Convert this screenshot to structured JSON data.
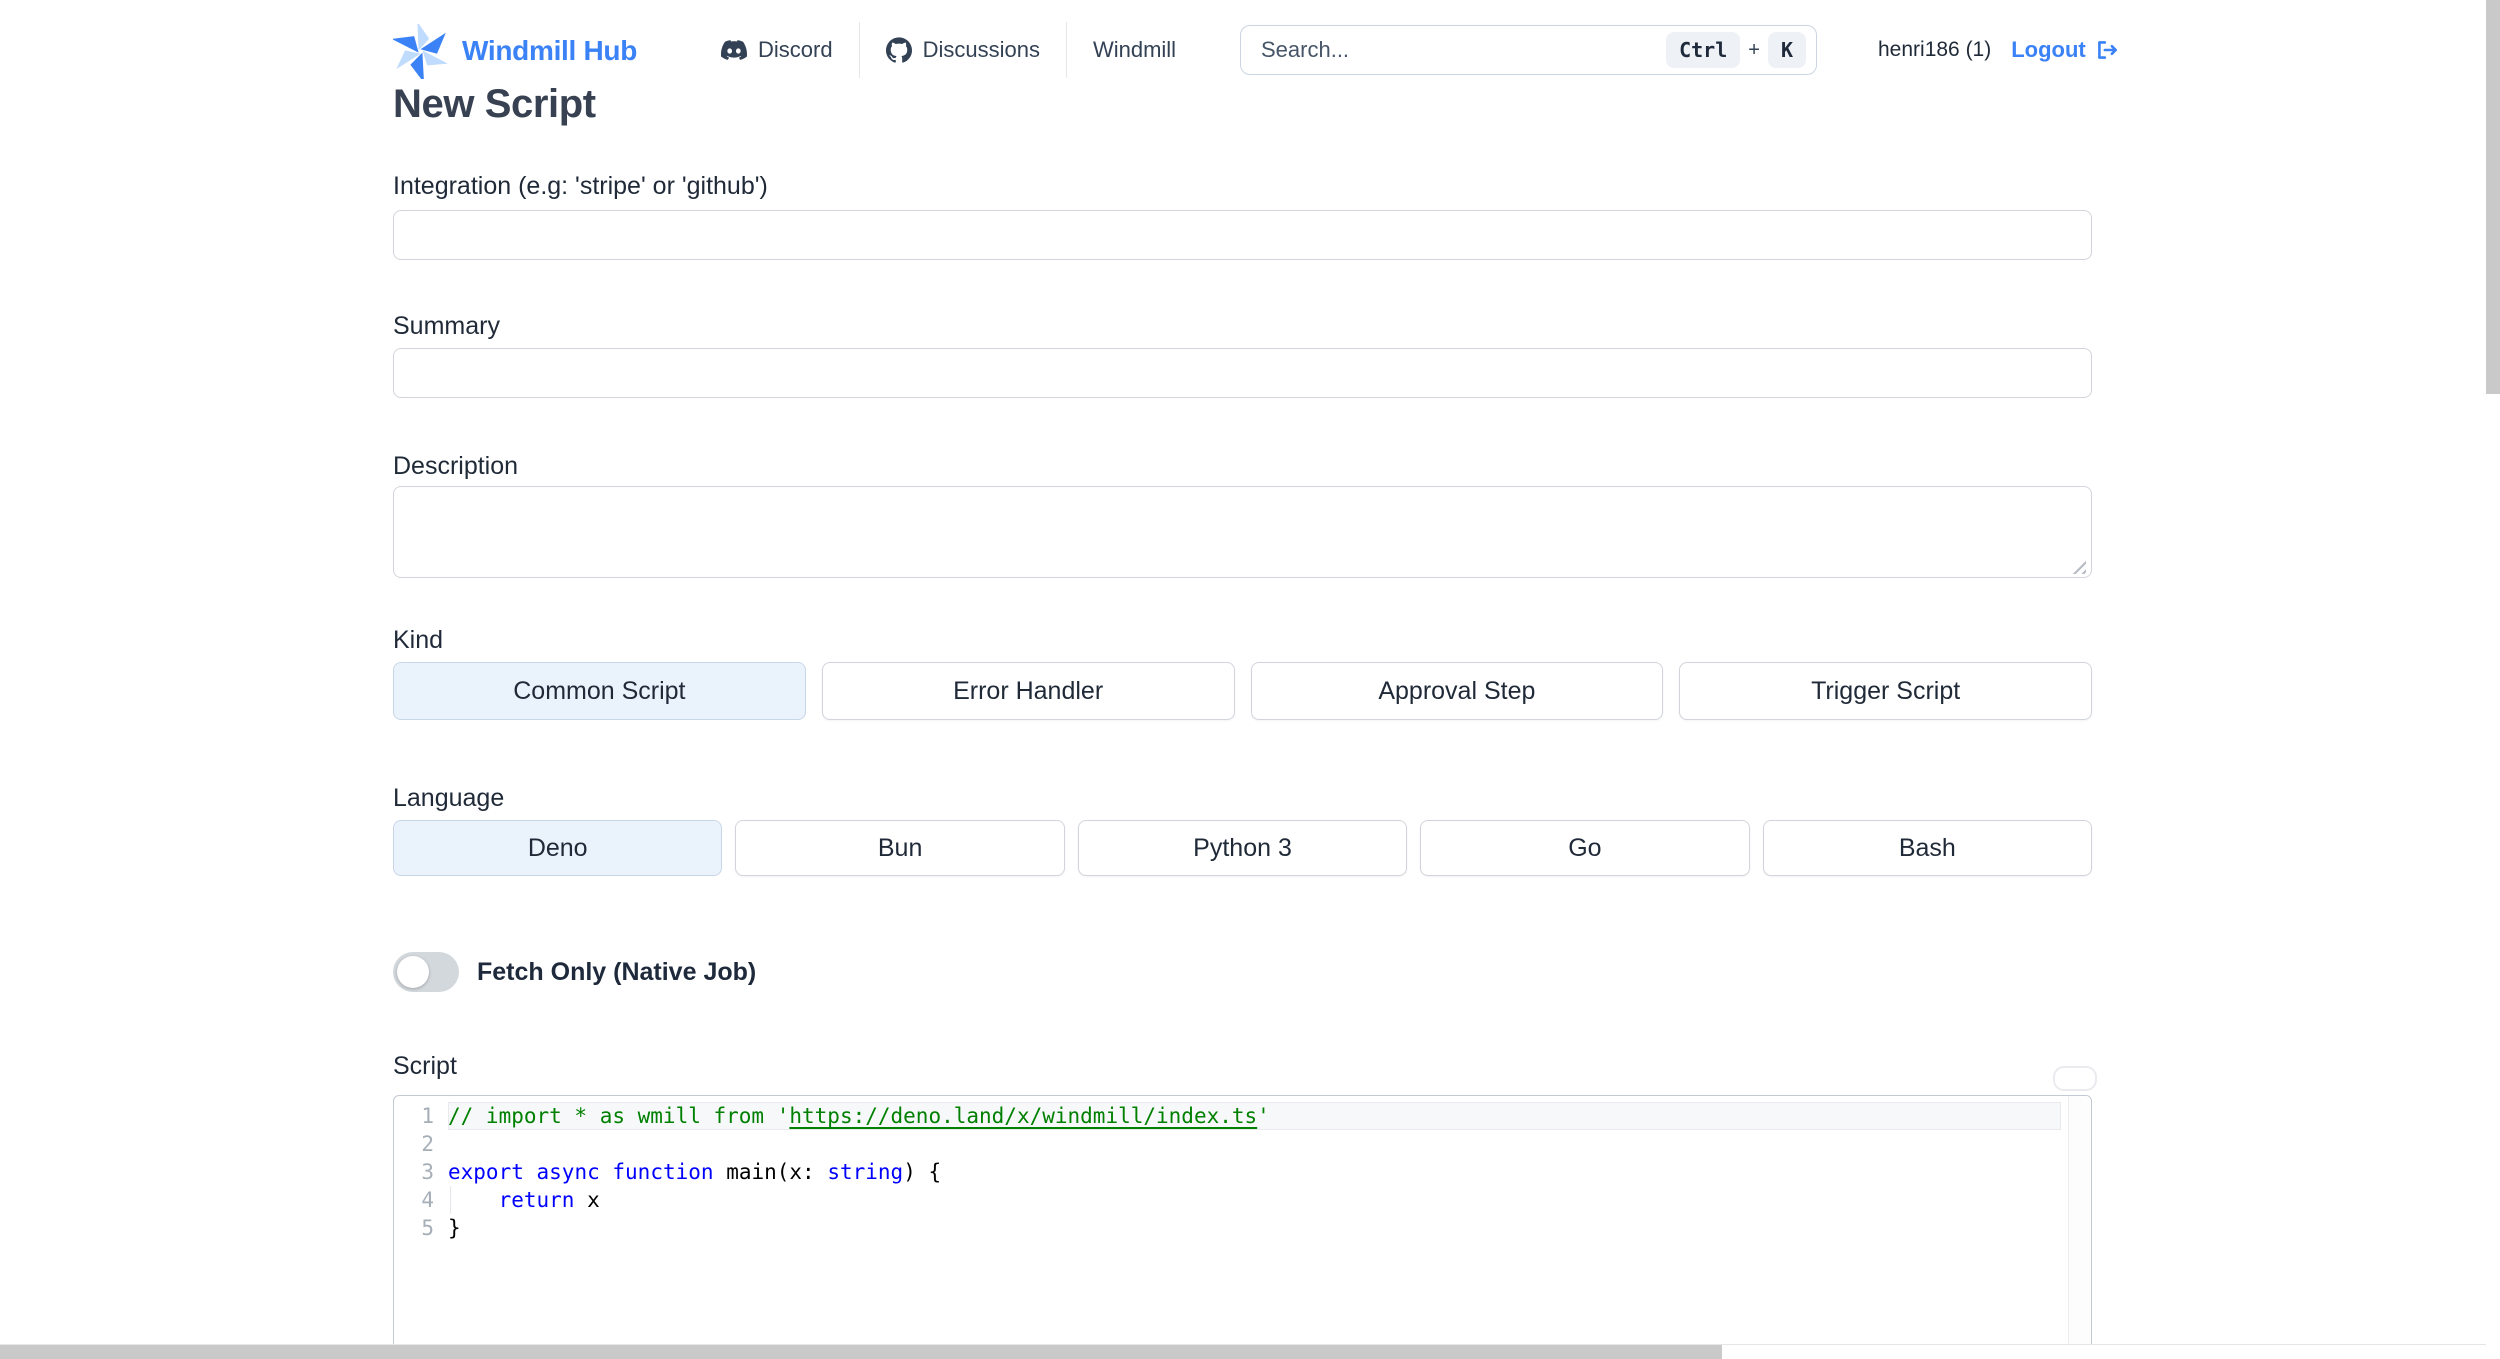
{
  "brand": {
    "name": "Windmill Hub"
  },
  "nav": {
    "items": [
      {
        "label": "Discord",
        "icon": "discord-icon"
      },
      {
        "label": "Discussions",
        "icon": "github-icon"
      },
      {
        "label": "Windmill",
        "icon": ""
      }
    ]
  },
  "search": {
    "placeholder": "Search...",
    "shortcut_keys": [
      "Ctrl",
      "K"
    ],
    "shortcut_separator": "+"
  },
  "user": {
    "name": "henri186 (1)",
    "logout_label": "Logout"
  },
  "page": {
    "title": "New Script"
  },
  "form": {
    "integration_label": "Integration (e.g: 'stripe' or 'github')",
    "integration_value": "",
    "summary_label": "Summary",
    "summary_value": "",
    "description_label": "Description",
    "description_value": "",
    "kind_label": "Kind",
    "kind_options": [
      "Common Script",
      "Error Handler",
      "Approval Step",
      "Trigger Script"
    ],
    "kind_selected": "Common Script",
    "language_label": "Language",
    "language_options": [
      "Deno",
      "Bun",
      "Python 3",
      "Go",
      "Bash"
    ],
    "language_selected": "Deno",
    "fetch_only_label": "Fetch Only (Native Job)",
    "fetch_only_on": false,
    "script_label": "Script"
  },
  "editor": {
    "lines": [
      {
        "num": "1",
        "current": true,
        "tokens": [
          [
            "comment",
            "// import * as wmill from '"
          ],
          [
            "comment-link",
            "https://deno.land/x/windmill/index.ts"
          ],
          [
            "comment",
            "'"
          ]
        ]
      },
      {
        "num": "2",
        "tokens": []
      },
      {
        "num": "3",
        "tokens": [
          [
            "kw",
            "export"
          ],
          [
            "plain",
            " "
          ],
          [
            "kw",
            "async"
          ],
          [
            "plain",
            " "
          ],
          [
            "kw",
            "function"
          ],
          [
            "plain",
            " main(x: "
          ],
          [
            "type",
            "string"
          ],
          [
            "plain",
            ") {"
          ]
        ]
      },
      {
        "num": "4",
        "indent_guide": true,
        "tokens": [
          [
            "plain",
            "    "
          ],
          [
            "kw",
            "return"
          ],
          [
            "plain",
            " x"
          ]
        ]
      },
      {
        "num": "5",
        "tokens": [
          [
            "plain",
            "}"
          ]
        ]
      }
    ]
  },
  "colors": {
    "brand_blue": "#3b82f6",
    "nav_text": "#334155",
    "selected_option_bg": "#eaf2fc",
    "selected_option_border": "#c8d7e8",
    "comment_green": "#008000",
    "keyword_blue": "#0000ff",
    "scrollbar_gray": "#c9c9c9"
  }
}
